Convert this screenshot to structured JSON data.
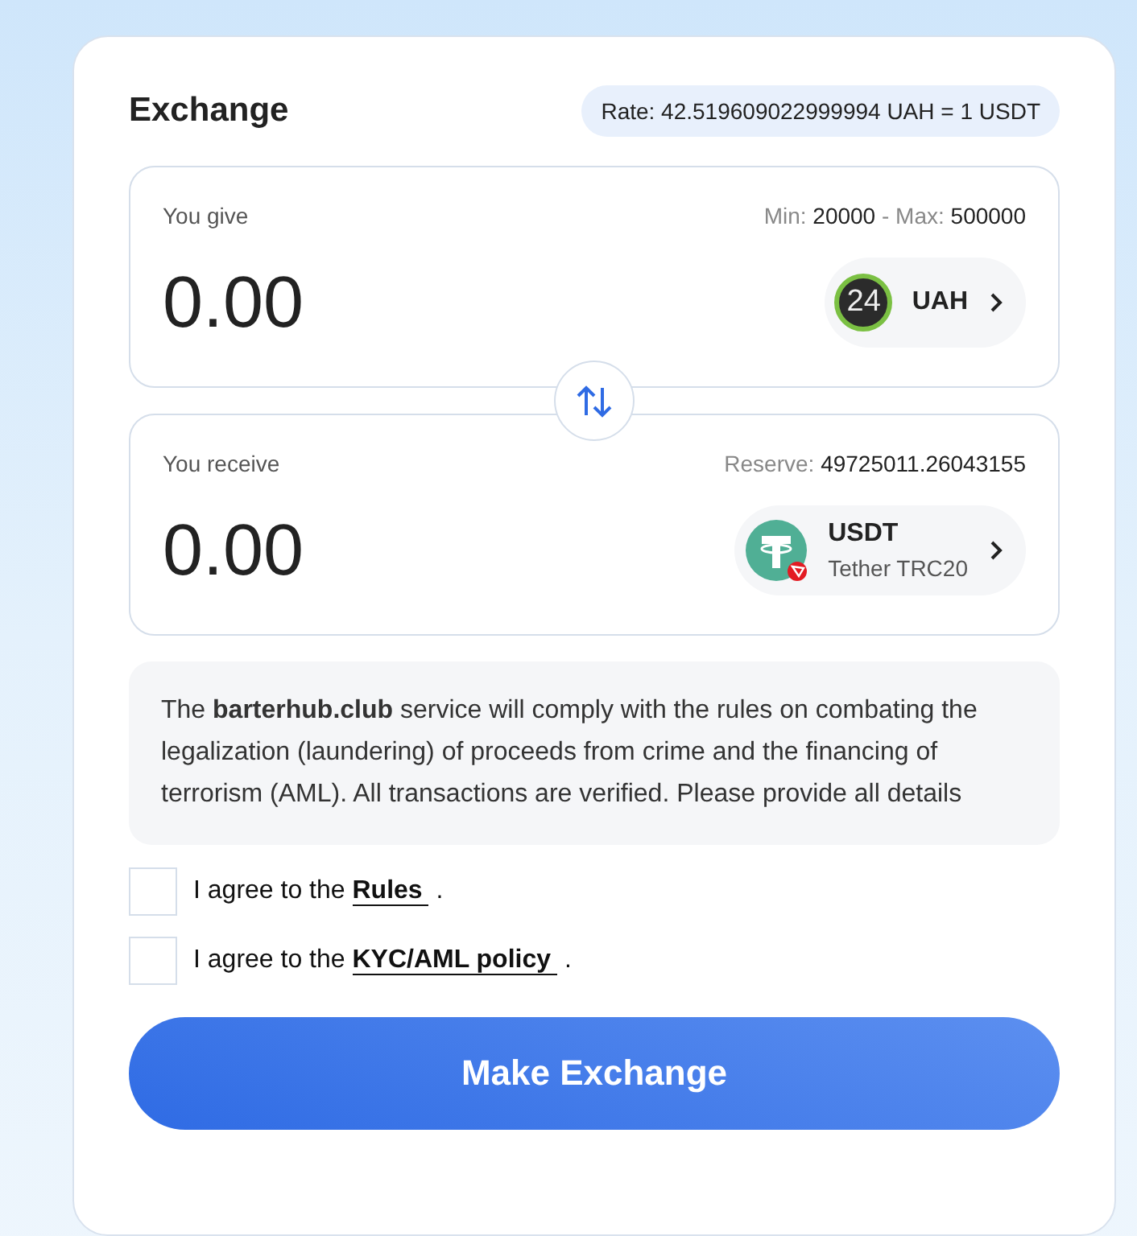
{
  "title": "Exchange",
  "rate": "Rate: 42.519609022999994 UAH = 1 USDT",
  "give": {
    "label": "You give",
    "info": [
      {
        "text": "Min:",
        "kind": "muted"
      },
      {
        "text": "20000",
        "kind": "value"
      },
      {
        "text": "-",
        "kind": "muted"
      },
      {
        "text": "Max:",
        "kind": "muted"
      },
      {
        "text": "500000",
        "kind": "value"
      }
    ],
    "amount": "0.00",
    "currency": {
      "kind": "badge24",
      "logo_text": "24",
      "code": "UAH"
    }
  },
  "receive": {
    "label": "You receive",
    "info": [
      {
        "text": "Reserve:",
        "kind": "muted"
      },
      {
        "text": "49725011.26043155",
        "kind": "value"
      }
    ],
    "amount": "0.00",
    "currency": {
      "kind": "tether",
      "code": "USDT",
      "network": "Tether TRC20"
    }
  },
  "notice": "The **barterhub.club** service will comply with the rules on combating the legalization (laundering) of proceeds from crime and the financing of terrorism (AML). All transactions are verified. Please provide all details",
  "agreements": [
    {
      "text": "I agree to the",
      "link": "Rules",
      "suffix": ".",
      "checked": false
    },
    {
      "text": "I agree to the",
      "link": "KYC/AML policy",
      "suffix": ".",
      "checked": false
    }
  ],
  "submit": "Make Exchange"
}
